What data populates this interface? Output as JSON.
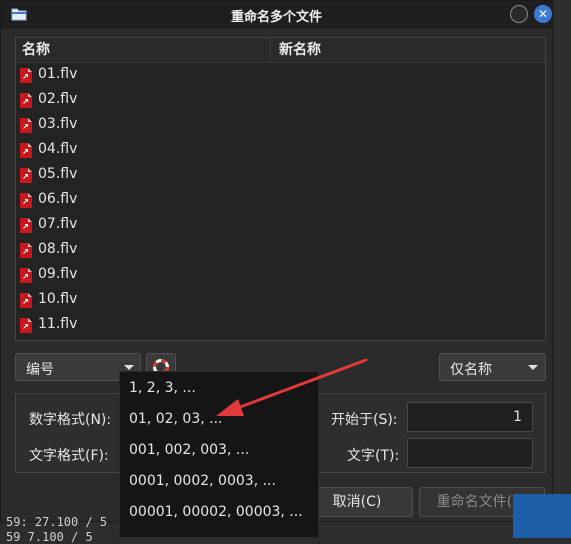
{
  "window": {
    "title": "重命名多个文件",
    "close_glyph": "✕"
  },
  "list": {
    "columns": {
      "name": "名称",
      "new_name": "新名称"
    },
    "files": [
      "01.flv",
      "02.flv",
      "03.flv",
      "04.flv",
      "05.flv",
      "06.flv",
      "07.flv",
      "08.flv",
      "09.flv",
      "10.flv",
      "11.flv"
    ]
  },
  "mode_dropdown": {
    "value": "编号"
  },
  "scope_dropdown": {
    "value": "仅名称"
  },
  "options": {
    "number_format_label": "数字格式(N):",
    "text_format_label": "文字格式(F):",
    "start_at_label": "开始于(S):",
    "start_at_value": "1",
    "text_label": "文字(T):",
    "text_value": ""
  },
  "number_format_popup": {
    "items": [
      "1, 2, 3, ...",
      "01, 02, 03, ...",
      "001, 002, 003, ...",
      "0001, 0002, 0003, ...",
      "00001, 00002, 00003, ..."
    ]
  },
  "buttons": {
    "cancel": "取消(C)",
    "rename": "重命名文件(R)"
  },
  "background": {
    "line1": "59: 27.100 / 5",
    "line2": "59   7.100 / 5"
  },
  "colors": {
    "accent": "#3d7ad6",
    "annotation_arrow": "#e03a3a",
    "file_icon": "#c8161d"
  }
}
